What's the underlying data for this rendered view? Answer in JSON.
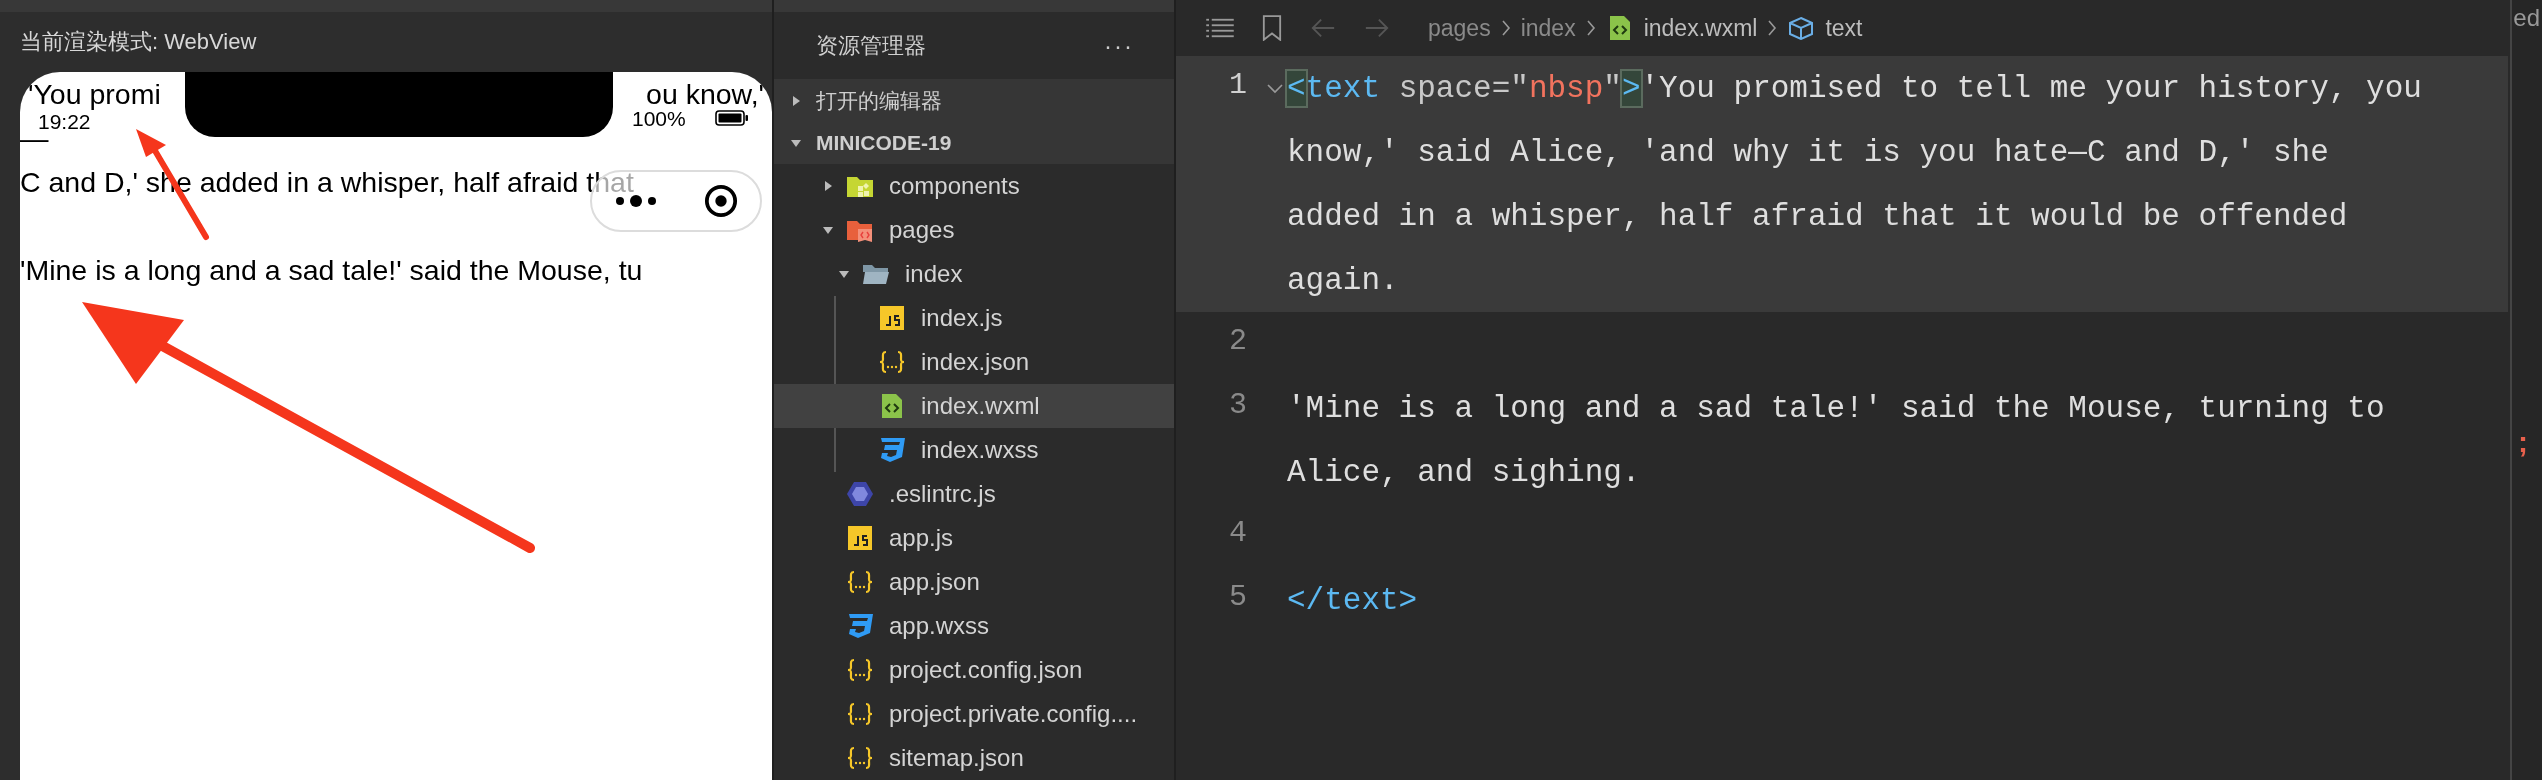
{
  "simulator": {
    "render_mode_label": "当前渲染模式: WebView",
    "status_bar": {
      "time": "19:22",
      "battery_text": "100%"
    },
    "lines": [
      {
        "kind": "split",
        "left": "'You promi",
        "right": "ou know,'"
      },
      {
        "kind": "plain",
        "text": "—"
      },
      {
        "kind": "plain",
        "text": "C and D,' she added in a whisper, half afraid that"
      },
      {
        "kind": "blank"
      },
      {
        "kind": "plain",
        "text": "'Mine is a long and a sad tale!' said the Mouse, tu"
      }
    ]
  },
  "explorer": {
    "title": "资源管理器",
    "more": "···",
    "sections": [
      {
        "label": "打开的编辑器",
        "expanded": false
      },
      {
        "label": "MINICODE-19",
        "expanded": true
      }
    ],
    "tree": [
      {
        "name": "components",
        "kind": "components",
        "expanded": false,
        "selected": false
      },
      {
        "name": "pages",
        "kind": "pages",
        "expanded": true,
        "selected": false,
        "children": [
          {
            "name": "index",
            "kind": "folder",
            "expanded": true,
            "selected": false,
            "children": [
              {
                "name": "index.js",
                "kind": "js",
                "selected": false
              },
              {
                "name": "index.json",
                "kind": "json",
                "selected": false
              },
              {
                "name": "index.wxml",
                "kind": "wxml",
                "selected": true
              },
              {
                "name": "index.wxss",
                "kind": "wxss",
                "selected": false
              }
            ]
          }
        ]
      },
      {
        "name": ".eslintrc.js",
        "kind": "eslint",
        "selected": false
      },
      {
        "name": "app.js",
        "kind": "js",
        "selected": false
      },
      {
        "name": "app.json",
        "kind": "json",
        "selected": false
      },
      {
        "name": "app.wxss",
        "kind": "wxss",
        "selected": false
      },
      {
        "name": "project.config.json",
        "kind": "json",
        "selected": false
      },
      {
        "name": "project.private.config....",
        "kind": "json",
        "selected": false
      },
      {
        "name": "sitemap.json",
        "kind": "json",
        "selected": false
      }
    ]
  },
  "editor": {
    "breadcrumb": [
      {
        "text": "pages",
        "kind": "folder"
      },
      {
        "text": "index",
        "kind": "folder"
      },
      {
        "text": "index.wxml",
        "kind": "file"
      },
      {
        "text": "text",
        "kind": "symbol"
      }
    ],
    "lines": [
      {
        "number": "1",
        "current": true,
        "foldable": true,
        "tokens": [
          {
            "kind": "bracket",
            "text": "<"
          },
          {
            "kind": "tag",
            "text": "text"
          },
          {
            "kind": "attr",
            "text": " space="
          },
          {
            "kind": "punct",
            "text": "\""
          },
          {
            "kind": "string",
            "text": "nbsp"
          },
          {
            "kind": "punct",
            "text": "\""
          },
          {
            "kind": "bracket",
            "text": ">"
          },
          {
            "kind": "text",
            "text": "'You promised to tell me your history, you"
          }
        ],
        "wrapped": [
          "know,' said Alice, 'and why it is you hate—C and D,' she",
          "added in a whisper, half afraid that it would be offended",
          "again."
        ]
      },
      {
        "number": "2",
        "current": false,
        "foldable": false
      },
      {
        "number": "3",
        "current": false,
        "foldable": false,
        "tokens": [
          {
            "kind": "text",
            "text": "'Mine is a long and a sad tale!' said the Mouse, turning to"
          }
        ],
        "wrapped": [
          "Alice, and sighing."
        ]
      },
      {
        "number": "4",
        "current": false,
        "foldable": false
      },
      {
        "number": "5",
        "current": false,
        "foldable": false,
        "tokens": [
          {
            "kind": "tag",
            "text": "</text>"
          }
        ]
      }
    ]
  },
  "side_strip": {
    "top_text": "ed",
    "mark": ";"
  }
}
